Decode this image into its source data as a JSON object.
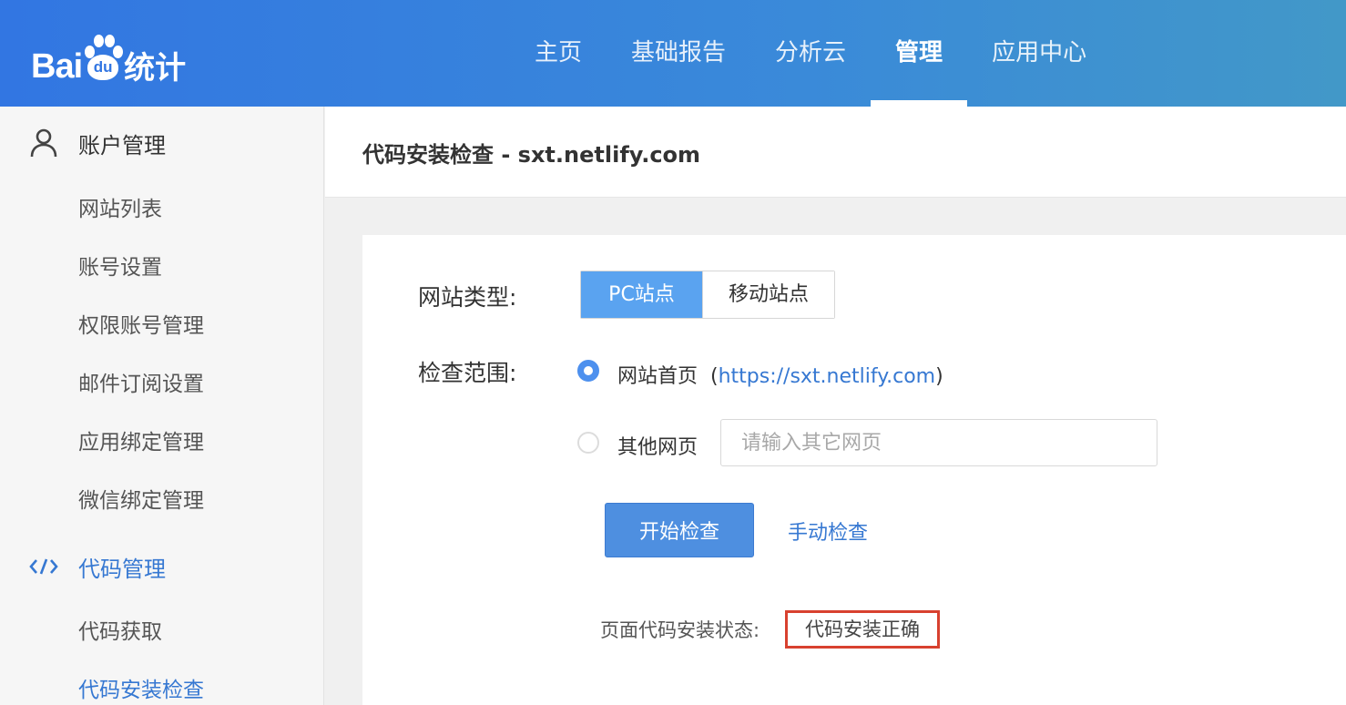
{
  "logo": {
    "latin": "Bai",
    "paw_text": "du",
    "cn": "统计"
  },
  "nav": {
    "items": [
      {
        "label": "主页"
      },
      {
        "label": "基础报告"
      },
      {
        "label": "分析云"
      },
      {
        "label": "管理"
      },
      {
        "label": "应用中心"
      }
    ],
    "active": "管理"
  },
  "sidebar": {
    "account_group": {
      "label": "账户管理",
      "icon": "user-icon"
    },
    "account_items": [
      "网站列表",
      "账号设置",
      "权限账号管理",
      "邮件订阅设置",
      "应用绑定管理",
      "微信绑定管理"
    ],
    "code_group": {
      "label": "代码管理",
      "icon": "code-icon"
    },
    "code_items": [
      "代码获取",
      "代码安装检查"
    ],
    "active_item": "代码安装检查"
  },
  "page": {
    "title": "代码安装检查 - sxt.netlify.com"
  },
  "form": {
    "site_type_label": "网站类型:",
    "site_type_options": [
      "PC站点",
      "移动站点"
    ],
    "site_type_selected": "PC站点",
    "scope_label": "检查范围:",
    "scope_home_label": "网站首页",
    "scope_home_url": "https://sxt.netlify.com",
    "scope_other_label": "其他网页",
    "other_page_placeholder": "请输入其它网页",
    "other_page_value": "",
    "start_button": "开始检查",
    "manual_link": "手动检查",
    "status_label": "页面代码安装状态:",
    "status_value": "代码安装正确"
  },
  "colors": {
    "header_start": "#3276e2",
    "header_end": "#4298c8",
    "accent": "#3678d2",
    "segment_active": "#5aa3f0",
    "status_border": "#d8412f"
  }
}
